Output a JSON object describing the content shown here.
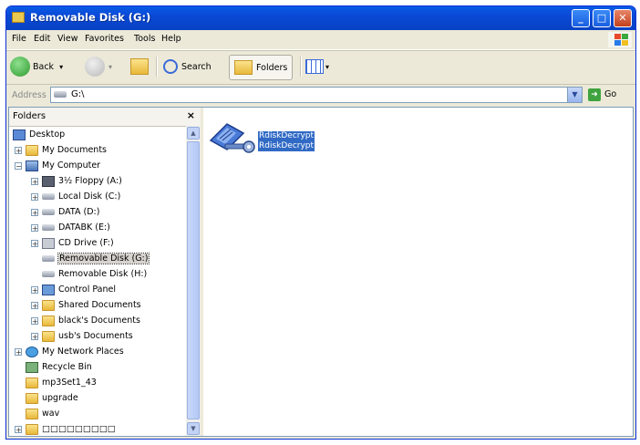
{
  "window": {
    "title": "Removable Disk (G:)"
  },
  "menu": [
    "File",
    "Edit",
    "View",
    "Favorites",
    "Tools",
    "Help"
  ],
  "toolbar": {
    "back": "Back",
    "search": "Search",
    "folders": "Folders"
  },
  "address": {
    "label": "Address",
    "value": "G:\\",
    "go": "Go"
  },
  "folders_pane": {
    "title": "Folders",
    "close": "×",
    "items": [
      {
        "label": "Desktop",
        "icon": "desktop-icon"
      },
      {
        "label": "My Documents",
        "icon": "folder-icon"
      },
      {
        "label": "My Computer",
        "icon": "computer-icon"
      },
      {
        "label": "3½ Floppy (A:)",
        "icon": "floppy-icon"
      },
      {
        "label": "Local Disk (C:)",
        "icon": "drive-icon"
      },
      {
        "label": "DATA (D:)",
        "icon": "drive-icon"
      },
      {
        "label": "DATABK (E:)",
        "icon": "drive-icon"
      },
      {
        "label": "CD Drive (F:)",
        "icon": "cd-drive-icon"
      },
      {
        "label": "Removable Disk (G:)",
        "icon": "removable-disk-icon"
      },
      {
        "label": "Removable Disk (H:)",
        "icon": "removable-disk-icon"
      },
      {
        "label": "Control Panel",
        "icon": "control-panel-icon"
      },
      {
        "label": "Shared Documents",
        "icon": "folder-icon"
      },
      {
        "label": "black's Documents",
        "icon": "folder-icon"
      },
      {
        "label": "usb's Documents",
        "icon": "folder-icon"
      },
      {
        "label": "My Network Places",
        "icon": "network-icon"
      },
      {
        "label": "Recycle Bin",
        "icon": "recycle-bin-icon"
      },
      {
        "label": "mp3Set1_43",
        "icon": "folder-icon"
      },
      {
        "label": "upgrade",
        "icon": "folder-icon"
      },
      {
        "label": "wav",
        "icon": "folder-icon"
      },
      {
        "label": "□□□□□□□□□",
        "icon": "folder-icon"
      }
    ]
  },
  "files": [
    {
      "name_line1": "RdiskDecrypt",
      "name_line2": "RdiskDecrypt",
      "icon": "rdisk-decrypt-app-icon",
      "selected": true
    }
  ],
  "colors": {
    "titlebar": "#0a49d6",
    "selection": "#316ac5",
    "chrome": "#ece9d8"
  }
}
